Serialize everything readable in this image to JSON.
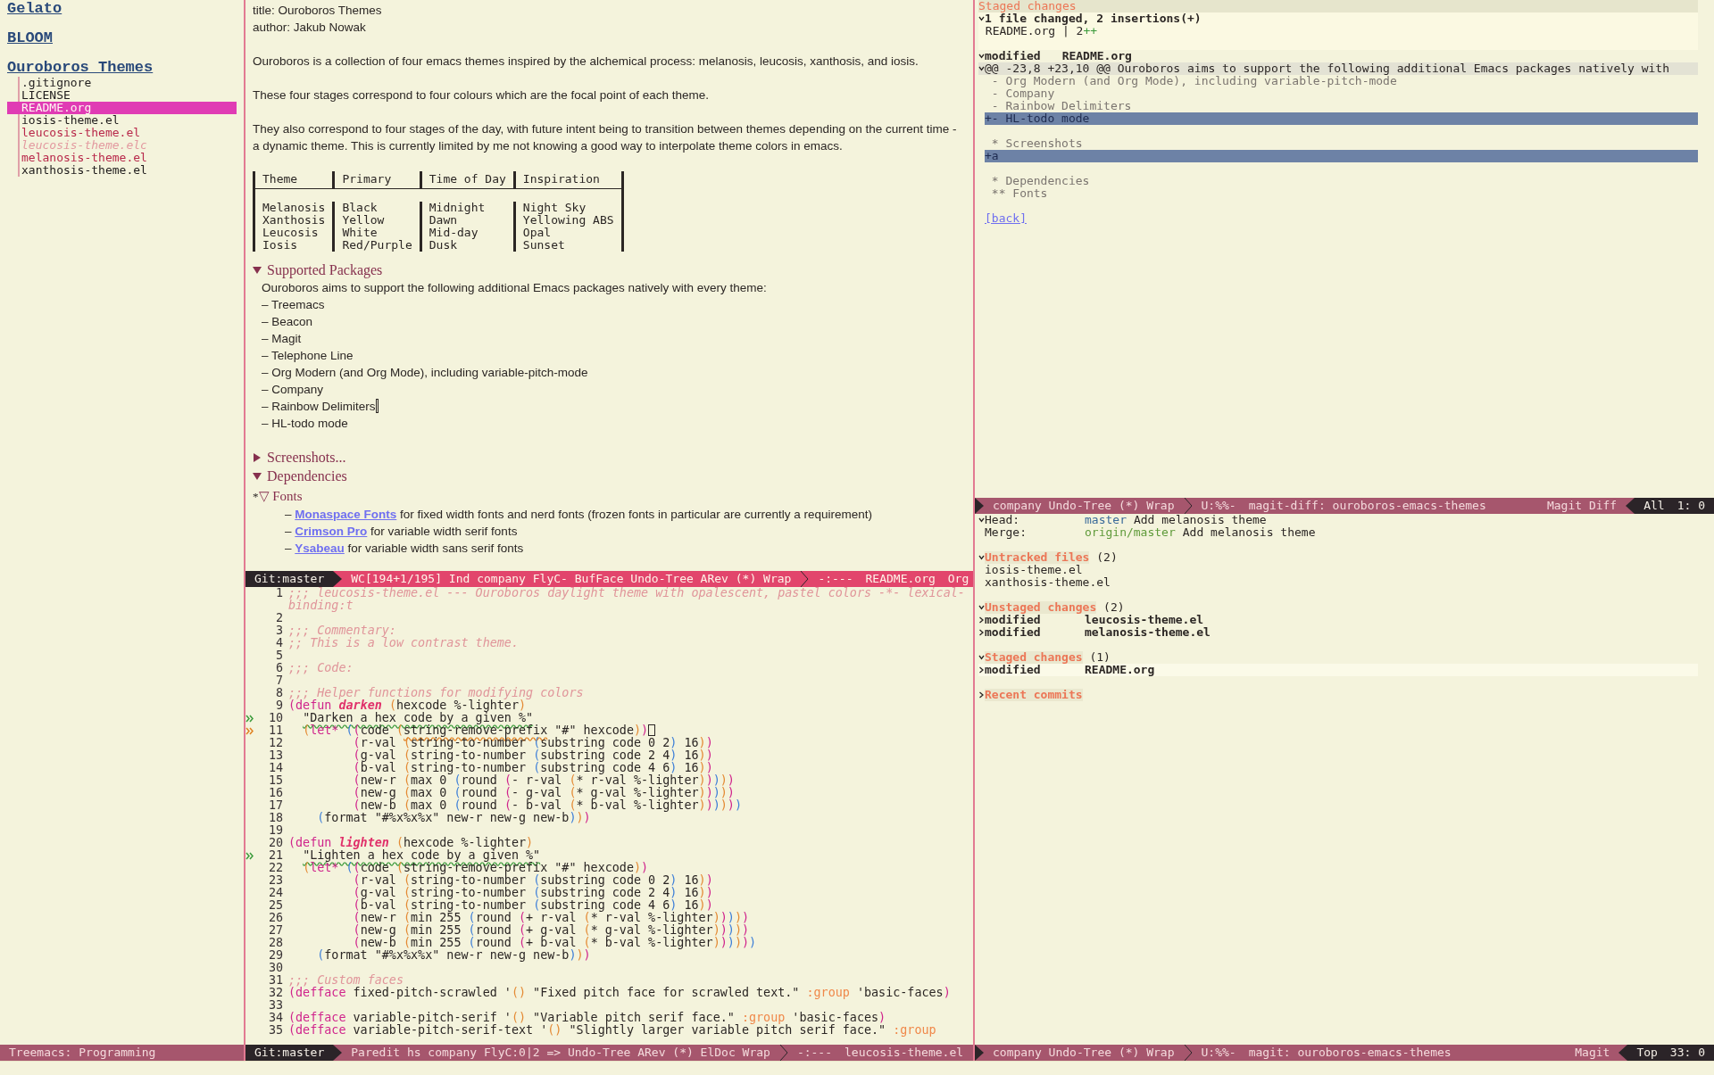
{
  "treemacs": {
    "projects": [
      {
        "name": "Gelato"
      },
      {
        "name": "BLOOM"
      },
      {
        "name": "Ouroboros Themes",
        "files": [
          {
            "name": ".gitignore",
            "kind": "clean",
            "selected": false
          },
          {
            "name": "LICENSE",
            "kind": "clean",
            "selected": false
          },
          {
            "name": "README.org",
            "kind": "clean",
            "selected": true
          },
          {
            "name": "iosis-theme.el",
            "kind": "clean",
            "selected": false
          },
          {
            "name": "leucosis-theme.el",
            "kind": "modified",
            "selected": false
          },
          {
            "name": "leucosis-theme.elc",
            "kind": "ignored",
            "selected": false
          },
          {
            "name": "melanosis-theme.el",
            "kind": "modified",
            "selected": false
          },
          {
            "name": "xanthosis-theme.el",
            "kind": "clean",
            "selected": false
          }
        ]
      }
    ],
    "modeline": {
      "active": false,
      "lead": false,
      "blocks": [
        {
          "kind": "main",
          "texts": [
            {
              "text": "Treemacs: Programming"
            }
          ]
        }
      ]
    }
  },
  "org": {
    "meta": [
      "title: Ouroboros Themes",
      "author: Jakub Nowak"
    ],
    "paragraphs": [
      "Ouroboros is a collection of four emacs themes inspired by the alchemical process: melanosis, leucosis, xanthosis, and iosis.",
      "These four stages correspond to four colours which are the focal point of each theme.",
      "They also correspond to four stages of the day, with future intent being to transition between themes depending on the current time - a dynamic theme. This is currently limited by me not knowing a good way to interpolate theme colors in emacs."
    ],
    "table": {
      "columns": [
        "Theme",
        "Primary",
        "Time of Day",
        "Inspiration"
      ],
      "rows": [
        [
          "Melanosis",
          "Black",
          "Midnight",
          "Night Sky"
        ],
        [
          "Xanthosis",
          "Yellow",
          "Dawn",
          "Yellowing ABS"
        ],
        [
          "Leucosis",
          "White",
          "Mid-day",
          "Opal"
        ],
        [
          "Iosis",
          "Red/Purple",
          "Dusk",
          "Sunset"
        ]
      ]
    },
    "sections": [
      {
        "title": "Supported Packages",
        "expanded": true,
        "intro": "Ouroboros aims to support the following additional Emacs packages natively with every theme:",
        "items": [
          {
            "text": "– Treemacs",
            "cursor": false
          },
          {
            "text": "– Beacon",
            "cursor": false
          },
          {
            "text": "– Magit",
            "cursor": false
          },
          {
            "text": "– Telephone Line",
            "cursor": false
          },
          {
            "text": "– Org Modern (and Org Mode), including variable-pitch-mode",
            "cursor": false
          },
          {
            "text": "– Company",
            "cursor": false
          },
          {
            "text": "– Rainbow Delimiters",
            "cursor": true
          },
          {
            "text": "– HL-todo mode",
            "cursor": false
          }
        ]
      },
      {
        "title": "Screenshots...",
        "expanded": false
      },
      {
        "title": "Dependencies",
        "expanded": true,
        "subsections": [
          {
            "prefix": "*",
            "marker": "▽",
            "title": "Fonts",
            "items": [
              {
                "dash": "–",
                "link": "Monaspace Fonts",
                "text": "for fixed width fonts and nerd fonts (frozen fonts in particular are currently a requirement)"
              },
              {
                "dash": "–",
                "link": "Crimson Pro",
                "text": "for variable width serif fonts"
              },
              {
                "dash": "–",
                "link": "Ysabeau",
                "text": "for variable width sans serif fonts"
              }
            ]
          }
        ]
      }
    ],
    "modeline": {
      "active": true,
      "lead": false,
      "blocks": [
        {
          "kind": "dark",
          "texts": [
            {
              "text": "Git:master"
            }
          ]
        },
        {
          "kind": "main",
          "texts": [
            {
              "text": "WC[194+1/195] Ind company FlyC- BufFace Undo-Tree ARev (*) Wrap"
            }
          ]
        },
        {
          "kind": "main",
          "last_right": true,
          "texts": [
            {
              "text": "-:---"
            },
            {
              "text": "README.org"
            },
            {
              "text": "Org"
            }
          ]
        }
      ]
    }
  },
  "code": {
    "lines": [
      {
        "number": "1",
        "parts": [
          {
            "kind": "comment",
            "text": ";;; leucosis-theme.el --- Ouroboros daylight theme with opalescent, pastel colors -*- lexical-binding:t"
          }
        ]
      },
      {
        "number": "2"
      },
      {
        "number": "3",
        "parts": [
          {
            "kind": "comment",
            "text": ";;; Commentary:"
          }
        ]
      },
      {
        "number": "4",
        "parts": [
          {
            "kind": "comment",
            "text": ";; This is a low contrast theme."
          }
        ]
      },
      {
        "number": "5"
      },
      {
        "number": "6",
        "parts": [
          {
            "kind": "comment",
            "text": ";;; Code:"
          }
        ]
      },
      {
        "number": "7"
      },
      {
        "number": "8",
        "parts": [
          {
            "kind": "comment",
            "text": ";;; Helper functions for modifying colors"
          }
        ]
      },
      {
        "number": "9",
        "parts": [
          {
            "kind": "plain",
            "text": "("
          },
          {
            "kind": "keyword",
            "text": "defun "
          },
          {
            "kind": "name",
            "text": "darken"
          },
          {
            "kind": "plain",
            "text": " (hexcode %-lighter)"
          }
        ]
      },
      {
        "number": "10",
        "fringe": {
          "kind": "info"
        },
        "parts": [
          {
            "kind": "string",
            "underline": {
              "kind": "info"
            },
            "text": "  \"Darken a hex code by a given %\""
          }
        ]
      },
      {
        "number": "11",
        "fringe": {
          "kind": "warning"
        },
        "cursor": true,
        "parts": [
          {
            "kind": "plain",
            "text": "  ("
          },
          {
            "kind": "keyword",
            "text": "let*"
          },
          {
            "kind": "plain",
            "text": " ((code ("
          },
          {
            "kind": "plain",
            "underline": {
              "kind": "warning"
            },
            "text": "string-remove-prefix"
          },
          {
            "kind": "plain",
            "text": " \"#\" hexcode))"
          }
        ]
      },
      {
        "number": "12",
        "parts": [
          {
            "kind": "plain",
            "text": "         (r-val (string-to-number (substring code 0 2) 16))"
          }
        ]
      },
      {
        "number": "13",
        "parts": [
          {
            "kind": "plain",
            "text": "         (g-val (string-to-number (substring code 2 4) 16))"
          }
        ]
      },
      {
        "number": "14",
        "parts": [
          {
            "kind": "plain",
            "text": "         (b-val (string-to-number (substring code 4 6) 16))"
          }
        ]
      },
      {
        "number": "15",
        "parts": [
          {
            "kind": "plain",
            "text": "         (new-r (max 0 (round (- r-val (* r-val %-lighter)))))"
          }
        ]
      },
      {
        "number": "16",
        "parts": [
          {
            "kind": "plain",
            "text": "         (new-g (max 0 (round (- g-val (* g-val %-lighter)))))"
          }
        ]
      },
      {
        "number": "17",
        "parts": [
          {
            "kind": "plain",
            "text": "         (new-b (max 0 (round (- b-val (* b-val %-lighter))))))"
          }
        ]
      },
      {
        "number": "18",
        "parts": [
          {
            "kind": "plain",
            "text": "    (format \"#%x%x%x\" new-r new-g new-b)))"
          }
        ]
      },
      {
        "number": "19"
      },
      {
        "number": "20",
        "parts": [
          {
            "kind": "plain",
            "text": "("
          },
          {
            "kind": "keyword",
            "text": "defun "
          },
          {
            "kind": "name",
            "text": "lighten"
          },
          {
            "kind": "plain",
            "text": " (hexcode %-lighter)"
          }
        ]
      },
      {
        "number": "21",
        "fringe": {
          "kind": "info"
        },
        "parts": [
          {
            "kind": "string",
            "underline": {
              "kind": "info"
            },
            "text": "  \"Lighten a hex code by a given %\""
          }
        ]
      },
      {
        "number": "22",
        "parts": [
          {
            "kind": "plain",
            "text": "  ("
          },
          {
            "kind": "keyword",
            "text": "let*"
          },
          {
            "kind": "plain",
            "text": " ((code (string-remove-prefix \"#\" hexcode))"
          }
        ]
      },
      {
        "number": "23",
        "parts": [
          {
            "kind": "plain",
            "text": "         (r-val (string-to-number (substring code 0 2) 16))"
          }
        ]
      },
      {
        "number": "24",
        "parts": [
          {
            "kind": "plain",
            "text": "         (g-val (string-to-number (substring code 2 4) 16))"
          }
        ]
      },
      {
        "number": "25",
        "parts": [
          {
            "kind": "plain",
            "text": "         (b-val (string-to-number (substring code 4 6) 16))"
          }
        ]
      },
      {
        "number": "26",
        "parts": [
          {
            "kind": "plain",
            "text": "         (new-r (min 255 (round (+ r-val (* r-val %-lighter)))))"
          }
        ]
      },
      {
        "number": "27",
        "parts": [
          {
            "kind": "plain",
            "text": "         (new-g (min 255 (round (+ g-val (* g-val %-lighter)))))"
          }
        ]
      },
      {
        "number": "28",
        "parts": [
          {
            "kind": "plain",
            "text": "         (new-b (min 255 (round (+ b-val (* b-val %-lighter))))))"
          }
        ]
      },
      {
        "number": "29",
        "parts": [
          {
            "kind": "plain",
            "text": "    (format \"#%x%x%x\" new-r new-g new-b)))"
          }
        ]
      },
      {
        "number": "30"
      },
      {
        "number": "31",
        "parts": [
          {
            "kind": "comment",
            "text": ";;; Custom faces"
          }
        ]
      },
      {
        "number": "32",
        "parts": [
          {
            "kind": "plain",
            "text": "("
          },
          {
            "kind": "keyword",
            "text": "defface"
          },
          {
            "kind": "plain",
            "text": " fixed-pitch-scrawled '() \"Fixed pitch face for scrawled text.\" "
          },
          {
            "kind": "const",
            "text": ":group"
          },
          {
            "kind": "plain",
            "text": " 'basic-faces)"
          }
        ]
      },
      {
        "number": "33"
      },
      {
        "number": "34",
        "parts": [
          {
            "kind": "plain",
            "text": "("
          },
          {
            "kind": "keyword",
            "text": "defface"
          },
          {
            "kind": "plain",
            "text": " variable-pitch-serif '() \"Variable pitch serif face.\" "
          },
          {
            "kind": "const",
            "text": ":group"
          },
          {
            "kind": "plain",
            "text": " 'basic-faces)"
          }
        ]
      },
      {
        "number": "35",
        "parts": [
          {
            "kind": "plain",
            "text": "("
          },
          {
            "kind": "keyword",
            "text": "defface"
          },
          {
            "kind": "plain",
            "text": " variable-pitch-serif-text '() \"Slightly larger variable pitch serif face.\" "
          },
          {
            "kind": "const",
            "text": ":group"
          }
        ]
      }
    ],
    "modeline": {
      "active": false,
      "lead": false,
      "blocks": [
        {
          "kind": "dark",
          "texts": [
            {
              "text": "Git:master"
            }
          ]
        },
        {
          "kind": "main",
          "texts": [
            {
              "text": "Paredit hs company FlyC:0|2 => Undo-Tree ARev (*) ElDoc Wrap"
            }
          ]
        },
        {
          "kind": "main",
          "texts": [
            {
              "text": "-:---"
            },
            {
              "text": "leucosis-theme.el"
            }
          ]
        }
      ]
    }
  },
  "diff": {
    "header": "Staged changes",
    "stat": "1 file changed, 2 insertions(+)",
    "stat_file": "README.org | 2",
    "stat_plus": "++",
    "file": {
      "status": "modified",
      "name": "README.org",
      "expanded": true
    },
    "hunk": {
      "text": "@@ -23,8 +23,10 @@ Ouroboros aims to support the following additional Emacs packages natively with",
      "expanded": true
    },
    "lines": [
      {
        "kind": "context",
        "text": " - Org Modern (and Org Mode), including variable-pitch-mode"
      },
      {
        "kind": "context",
        "text": " - Company"
      },
      {
        "kind": "context",
        "text": " - Rainbow Delimiters"
      },
      {
        "kind": "added",
        "text": "+- HL-todo mode"
      },
      {
        "kind": "context"
      },
      {
        "kind": "context",
        "text": " * Screenshots"
      },
      {
        "kind": "added",
        "text": "+a"
      },
      {
        "kind": "context"
      },
      {
        "kind": "context",
        "text": " * Dependencies"
      },
      {
        "kind": "context",
        "text": " ** Fonts"
      }
    ],
    "back": "[back]",
    "modeline": {
      "active": false,
      "lead": true,
      "blocks": [
        {
          "kind": "main",
          "texts": [
            {
              "text": "company Undo-Tree (*) Wrap"
            }
          ]
        },
        {
          "kind": "main",
          "last_right": true,
          "texts": [
            {
              "text": "U:%%-"
            },
            {
              "text": "magit-diff: ouroboros-emacs-themes"
            },
            {
              "text": "Magit Diff"
            }
          ]
        },
        {
          "kind": "dark",
          "texts": [
            {
              "text": "All"
            },
            {
              "text": "1: 0"
            }
          ]
        }
      ]
    }
  },
  "status": {
    "refs": [
      {
        "label": "Head:",
        "branch": "master",
        "kind": "local",
        "message": "Add melanosis theme",
        "expanded": true
      },
      {
        "label": "Merge:",
        "branch": "origin/master",
        "kind": "remote",
        "message": "Add melanosis theme",
        "expanded": false
      }
    ],
    "sections": [
      {
        "title": "Untracked files",
        "count": "(2)",
        "expanded": true,
        "items": [
          {
            "kind": "file",
            "name": "iosis-theme.el",
            "selected": false
          },
          {
            "kind": "file",
            "name": "xanthosis-theme.el",
            "selected": false
          }
        ]
      },
      {
        "title": "Unstaged changes",
        "count": "(2)",
        "expanded": true,
        "items": [
          {
            "kind": "change",
            "status": "modified",
            "name": "leucosis-theme.el",
            "selected": false
          },
          {
            "kind": "change",
            "status": "modified",
            "name": "melanosis-theme.el",
            "selected": false
          }
        ]
      },
      {
        "title": "Staged changes",
        "count": "(1)",
        "expanded": true,
        "items": [
          {
            "kind": "change",
            "status": "modified",
            "name": "README.org",
            "selected": true
          }
        ]
      },
      {
        "title": "Recent commits",
        "expanded": false
      }
    ],
    "modeline": {
      "active": false,
      "lead": true,
      "blocks": [
        {
          "kind": "main",
          "texts": [
            {
              "text": "company Undo-Tree (*) Wrap"
            }
          ]
        },
        {
          "kind": "main",
          "last_right": true,
          "texts": [
            {
              "text": "U:%%-"
            },
            {
              "text": "magit: ouroboros-emacs-themes"
            },
            {
              "text": "Magit"
            }
          ]
        },
        {
          "kind": "dark",
          "texts": [
            {
              "text": "Top"
            },
            {
              "text": "33: 0"
            }
          ]
        }
      ]
    }
  }
}
